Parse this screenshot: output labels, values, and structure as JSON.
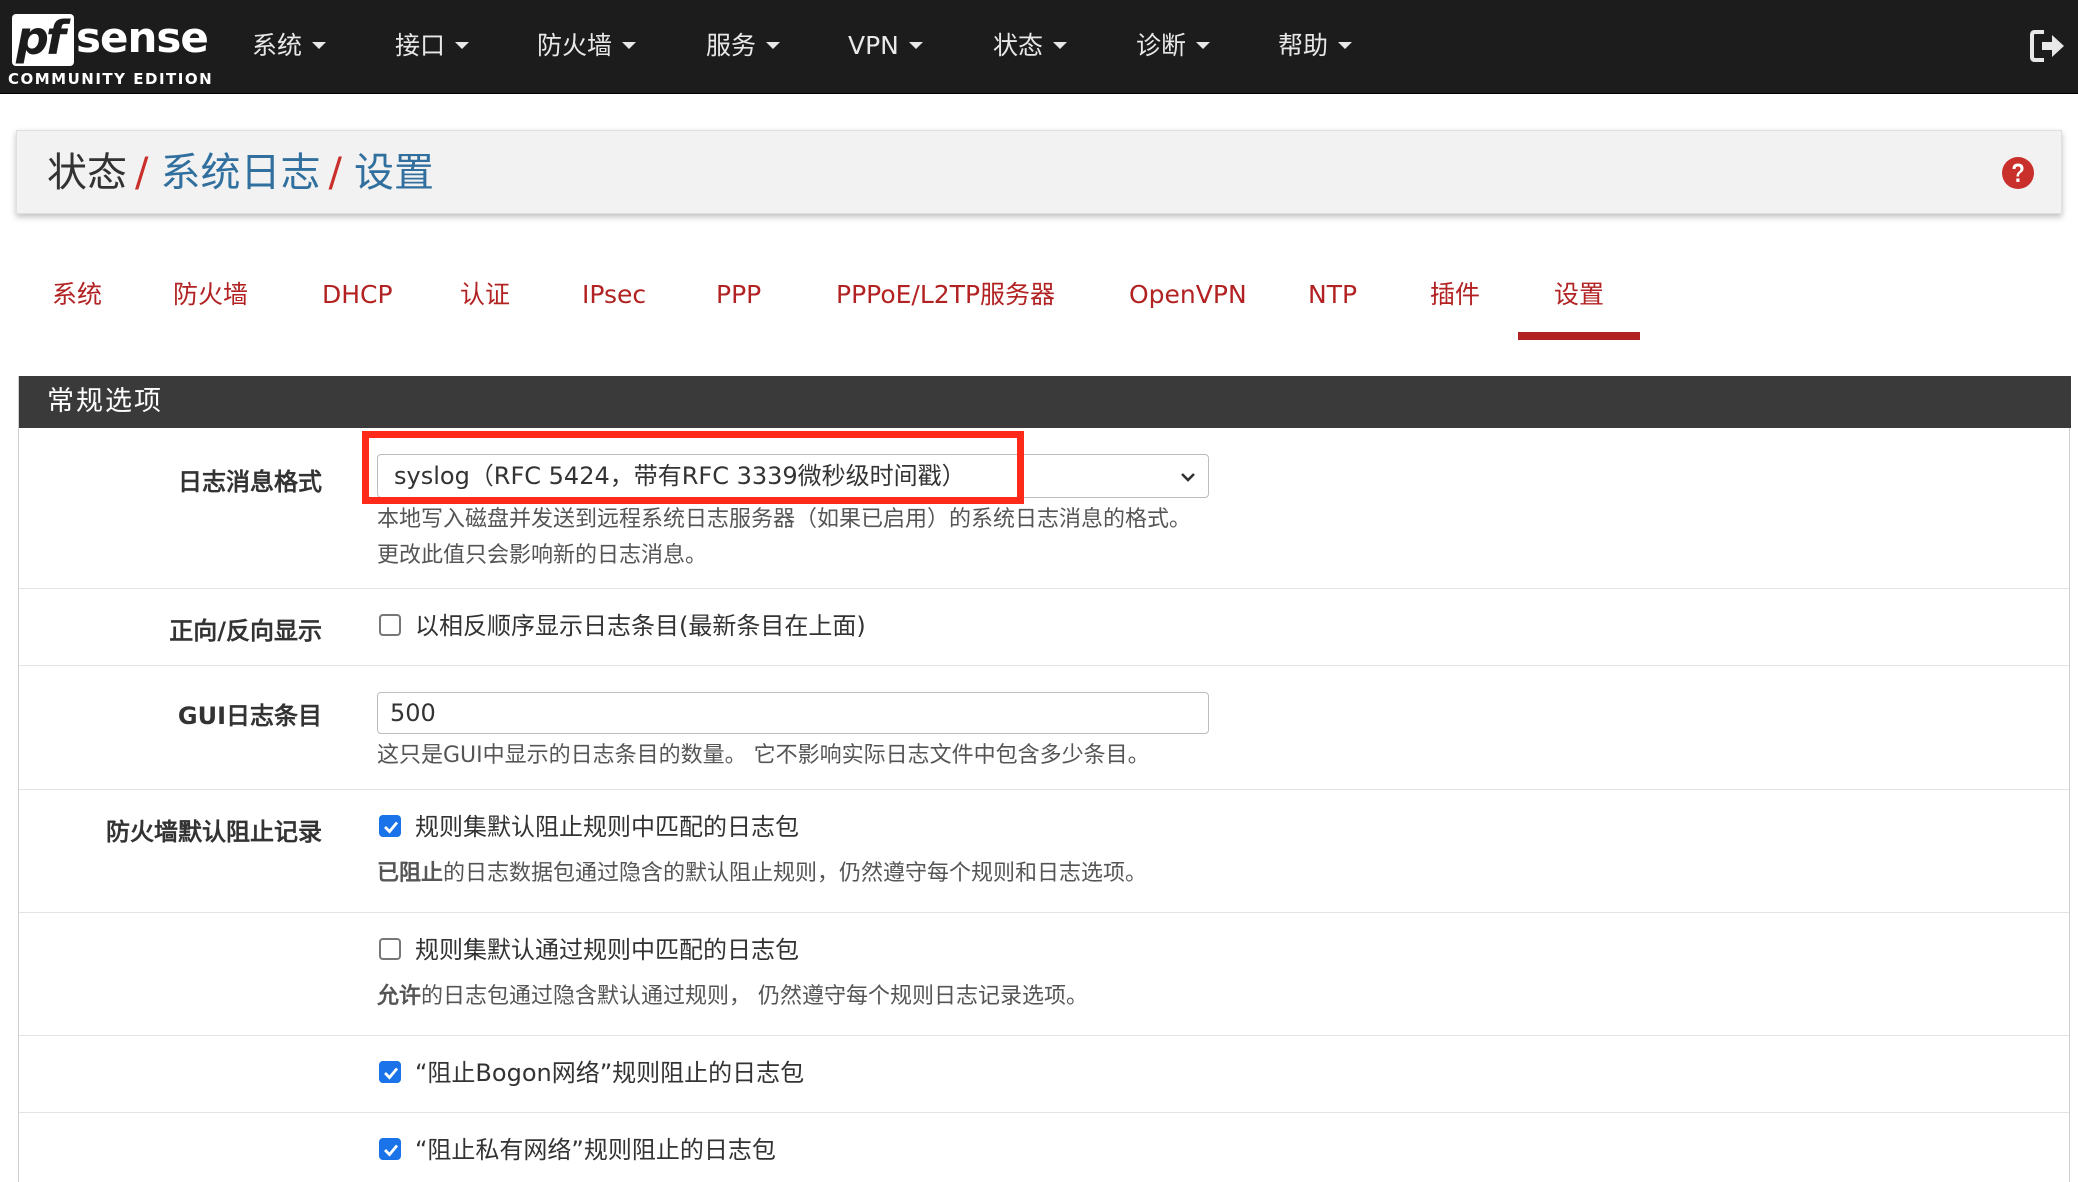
{
  "app": {
    "logo_brand_prefix": "pf",
    "logo_brand_suffix": "sense",
    "logo_edition": "COMMUNITY EDITION"
  },
  "nav": {
    "items": [
      {
        "label": "系统"
      },
      {
        "label": "接口"
      },
      {
        "label": "防火墙"
      },
      {
        "label": "服务"
      },
      {
        "label": "VPN"
      },
      {
        "label": "状态"
      },
      {
        "label": "诊断"
      },
      {
        "label": "帮助"
      }
    ],
    "logout_icon": "sign-out-icon"
  },
  "breadcrumb": {
    "root": "状态",
    "separator": "/",
    "level1": "系统日志",
    "level2": "设置",
    "help_icon": "question-circle-icon"
  },
  "tabs": [
    {
      "label": "系统",
      "active": false
    },
    {
      "label": "防火墙",
      "active": false
    },
    {
      "label": "DHCP",
      "active": false
    },
    {
      "label": "认证",
      "active": false
    },
    {
      "label": "IPsec",
      "active": false
    },
    {
      "label": "PPP",
      "active": false
    },
    {
      "label": "PPPoE/L2TP服务器",
      "active": false
    },
    {
      "label": "OpenVPN",
      "active": false
    },
    {
      "label": "NTP",
      "active": false
    },
    {
      "label": "插件",
      "active": false
    },
    {
      "label": "设置",
      "active": true
    }
  ],
  "panel": {
    "heading": "常规选项",
    "log_format": {
      "label": "日志消息格式",
      "selected": "syslog（RFC 5424，带有RFC 3339微秒级时间戳）",
      "help_line1": "本地写入磁盘并发送到远程系统日志服务器（如果已启用）的系统日志消息的格式。",
      "help_line2": "更改此值只会影响新的日志消息。"
    },
    "reverse_display": {
      "label": "正向/反向显示",
      "checkbox_label": "以相反顺序显示日志条目(最新条目在上面)",
      "checked": false
    },
    "gui_log_entries": {
      "label": "GUI日志条目",
      "value": "500",
      "help": "这只是GUI中显示的日志条目的数量。 它不影响实际日志文件中包含多少条目。"
    },
    "fw_default_block": {
      "label": "防火墙默认阻止记录",
      "opt1_label": "规则集默认阻止规则中匹配的日志包",
      "opt1_checked": true,
      "opt1_help_bold": "已阻止",
      "opt1_help_rest": "的日志数据包通过隐含的默认阻止规则，仍然遵守每个规则和日志选项。",
      "opt2_label": "规则集默认通过规则中匹配的日志包",
      "opt2_checked": false,
      "opt2_help_bold": "允许",
      "opt2_help_rest": "的日志包通过隐含默认通过规则， 仍然遵守每个规则日志记录选项。",
      "opt3_label": "“阻止Bogon网络”规则阻止的日志包",
      "opt3_checked": true,
      "opt4_label": "“阻止私有网络”规则阻止的日志包",
      "opt4_checked": true
    }
  },
  "colors": {
    "navbar_bg": "#1c1c1c",
    "tab_red": "#b22222",
    "breadcrumb_link": "#31709e",
    "panel_heading_bg": "#3a3a3a",
    "checkbox_blue": "#1a73e8",
    "highlight_red": "#ff2a1a"
  }
}
